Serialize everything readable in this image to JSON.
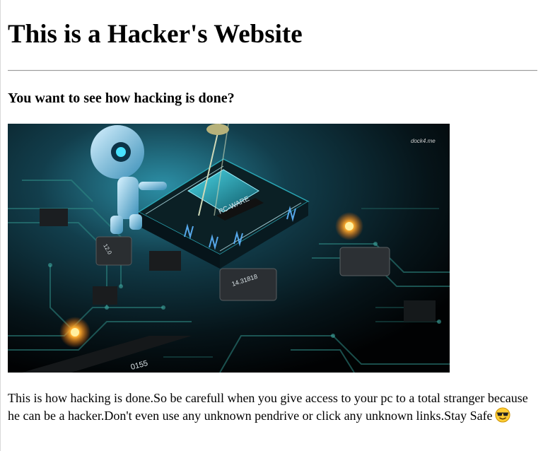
{
  "heading": "This is a Hacker's Website",
  "subheading": "You want to see how hacking is done?",
  "image": {
    "alt": "Hacker robot and circuit board",
    "chip_label": "PC-WARE",
    "watermark": "dock4.me",
    "component_labels": [
      "14.31818",
      "0155",
      "12.0"
    ]
  },
  "paragraph": "This is how hacking is done.So be carefull when you give access to your pc to a total stranger because he can be a hacker.Don't even use any unknown pendrive or click any unknown links.Stay Safe",
  "emoji_icon": "sunglasses-face-icon",
  "colors": {
    "text": "#000000",
    "background": "#ffffff",
    "rule": "#9a9a9a"
  }
}
